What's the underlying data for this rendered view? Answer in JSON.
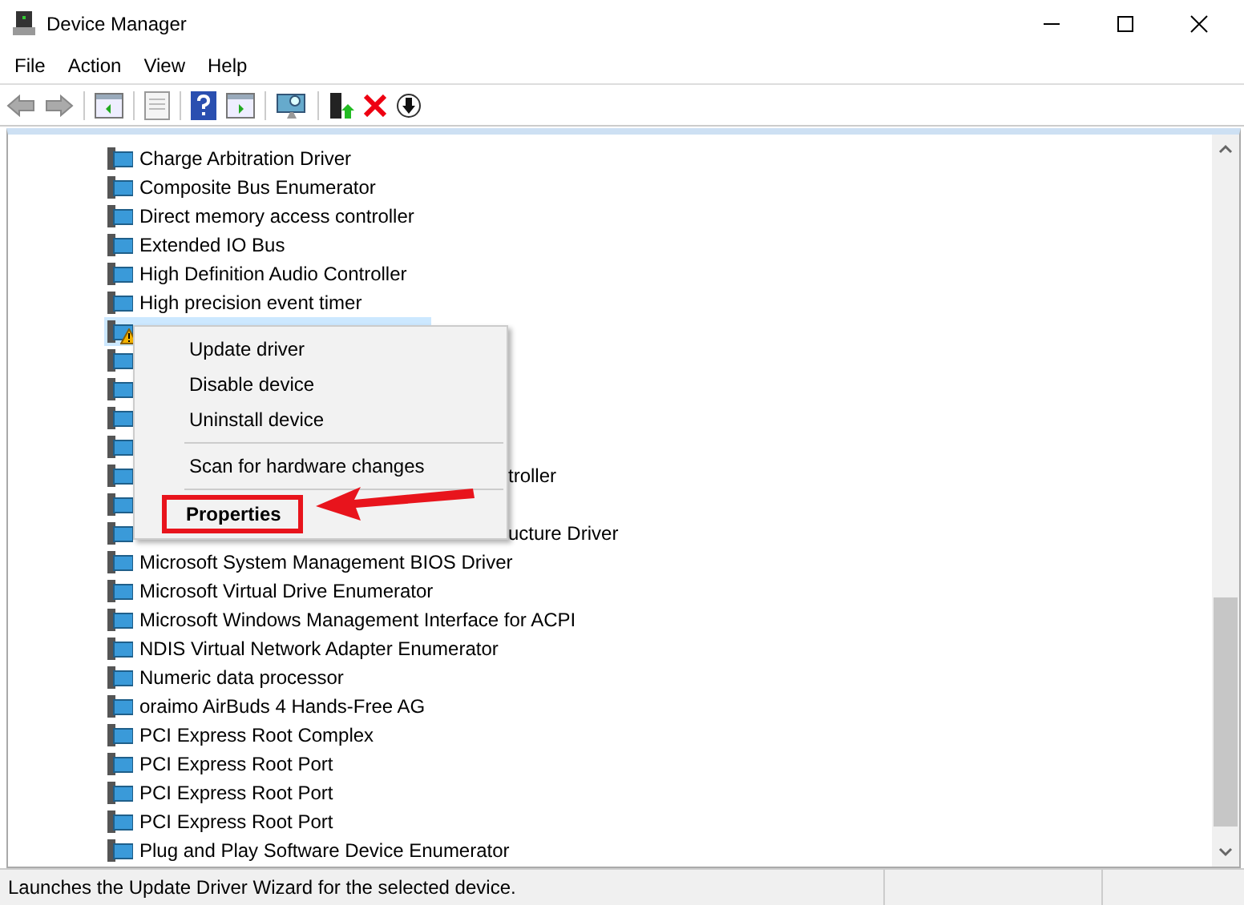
{
  "window": {
    "title": "Device Manager"
  },
  "menu_bar": [
    "File",
    "Action",
    "View",
    "Help"
  ],
  "tree": [
    {
      "kind": "device",
      "label": "Charge Arbitration Driver",
      "selected": false
    },
    {
      "kind": "device",
      "label": "Composite Bus Enumerator",
      "selected": false
    },
    {
      "kind": "device",
      "label": "Direct memory access controller",
      "selected": false
    },
    {
      "kind": "device",
      "label": "Extended IO Bus",
      "selected": false
    },
    {
      "kind": "device",
      "label": "High Definition Audio Controller",
      "selected": false
    },
    {
      "kind": "device",
      "label": "High precision event timer",
      "selected": false
    },
    {
      "kind": "warning",
      "selected": true
    },
    {
      "kind": "device",
      "selected": false
    },
    {
      "kind": "device",
      "selected": false
    },
    {
      "kind": "device",
      "selected": false
    },
    {
      "kind": "device",
      "selected": false
    },
    {
      "kind": "partial",
      "label": "troller",
      "selected": false
    },
    {
      "kind": "device",
      "selected": false
    },
    {
      "kind": "partial",
      "label": "ucture Driver",
      "selected": false
    },
    {
      "kind": "device",
      "label": "Microsoft System Management BIOS Driver",
      "selected": false
    },
    {
      "kind": "device",
      "label": "Microsoft Virtual Drive Enumerator",
      "selected": false
    },
    {
      "kind": "device",
      "label": "Microsoft Windows Management Interface for ACPI",
      "selected": false
    },
    {
      "kind": "device",
      "label": "NDIS Virtual Network Adapter Enumerator",
      "selected": false
    },
    {
      "kind": "device",
      "label": "Numeric data processor",
      "selected": false
    },
    {
      "kind": "device",
      "label": "oraimo AirBuds 4 Hands-Free AG",
      "selected": false
    },
    {
      "kind": "device",
      "label": "PCI Express Root Complex",
      "selected": false
    },
    {
      "kind": "device",
      "label": "PCI Express Root Port",
      "selected": false
    },
    {
      "kind": "device",
      "label": "PCI Express Root Port",
      "selected": false
    },
    {
      "kind": "device",
      "label": "PCI Express Root Port",
      "selected": false
    },
    {
      "kind": "device",
      "label": "Plug and Play Software Device Enumerator",
      "selected": false
    }
  ],
  "context_menu": [
    {
      "kind": "item",
      "label": "Update driver"
    },
    {
      "kind": "item",
      "label": "Disable device"
    },
    {
      "kind": "item",
      "label": "Uninstall device"
    },
    {
      "kind": "separator"
    },
    {
      "kind": "item",
      "label": "Scan for hardware changes"
    },
    {
      "kind": "separator"
    },
    {
      "kind": "highlighted",
      "label": "Properties"
    }
  ],
  "status_bar": "Launches the Update Driver Wizard for the selected device."
}
